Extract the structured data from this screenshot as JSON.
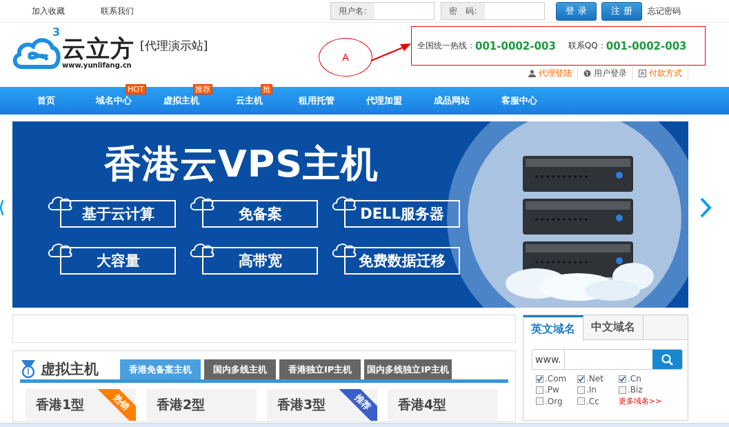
{
  "top_bar": {
    "links": [
      "加入收藏",
      "联系我们"
    ],
    "username_label": "用户名:",
    "password_label": "密　码:",
    "buttons": [
      "登 录",
      "注 册"
    ],
    "forgot_link": "忘记密码"
  },
  "header": {
    "logo_text": "云立方",
    "logo_superscript": "3",
    "logo_url": "www.yunlifang.cn",
    "site_tag": "[代理演示站]"
  },
  "annotation": {
    "label": "A",
    "hotline_label": "全国统一热线：",
    "hotline_number": "001-0002-003",
    "qq_label": "联系QQ：",
    "qq_number": "001-0002-003"
  },
  "quick_links": [
    {
      "label": "代理登陆",
      "kind": "person",
      "highlighted": true
    },
    {
      "label": "用户登录",
      "kind": "globe",
      "highlighted": false
    },
    {
      "label": "付款方式",
      "kind": "card",
      "highlighted": true
    }
  ],
  "nav": [
    {
      "label": "首页"
    },
    {
      "label": "域名中心",
      "badge": "HOT"
    },
    {
      "label": "虚拟主机",
      "badge": "推荐"
    },
    {
      "label": "云主机",
      "badge": "抢"
    },
    {
      "label": "租用托管"
    },
    {
      "label": "代理加盟"
    },
    {
      "label": "成品网站"
    },
    {
      "label": "客服中心"
    }
  ],
  "banner": {
    "title": "香港云VPS主机",
    "features": [
      "基于云计算",
      "免备案",
      "DELL服务器",
      "大容量",
      "高带宽",
      "免费数据迁移"
    ]
  },
  "virtual_hosts": {
    "title": "虚拟主机",
    "tabs": [
      {
        "label": "香港免备案主机",
        "selected": true
      },
      {
        "label": "国内多线主机",
        "selected": false
      },
      {
        "label": "香港独立IP主机",
        "selected": false
      },
      {
        "label": "国内多线独立IP主机",
        "selected": false
      }
    ],
    "plans": [
      {
        "name": "香港1型",
        "ribbon": "热销",
        "color": "#ff7f00"
      },
      {
        "name": "香港2型"
      },
      {
        "name": "香港3型",
        "ribbon": "推荐",
        "color": "#3a5fc8"
      },
      {
        "name": "香港4型"
      }
    ]
  },
  "domain_search": {
    "tabs": [
      {
        "label": "英文域名",
        "selected": true
      },
      {
        "label": "中文域名",
        "selected": false
      }
    ],
    "prefix": "www.",
    "tlds": [
      {
        "label": ".Com",
        "checked": true
      },
      {
        "label": ".Net",
        "checked": true
      },
      {
        "label": ".Cn",
        "checked": true
      },
      {
        "label": ".Pw",
        "checked": false
      },
      {
        "label": ".In",
        "checked": false
      },
      {
        "label": ".Biz",
        "checked": false
      },
      {
        "label": ".Org",
        "checked": false
      },
      {
        "label": ".Cc",
        "checked": false
      }
    ],
    "more_link": "更多域名>>"
  }
}
